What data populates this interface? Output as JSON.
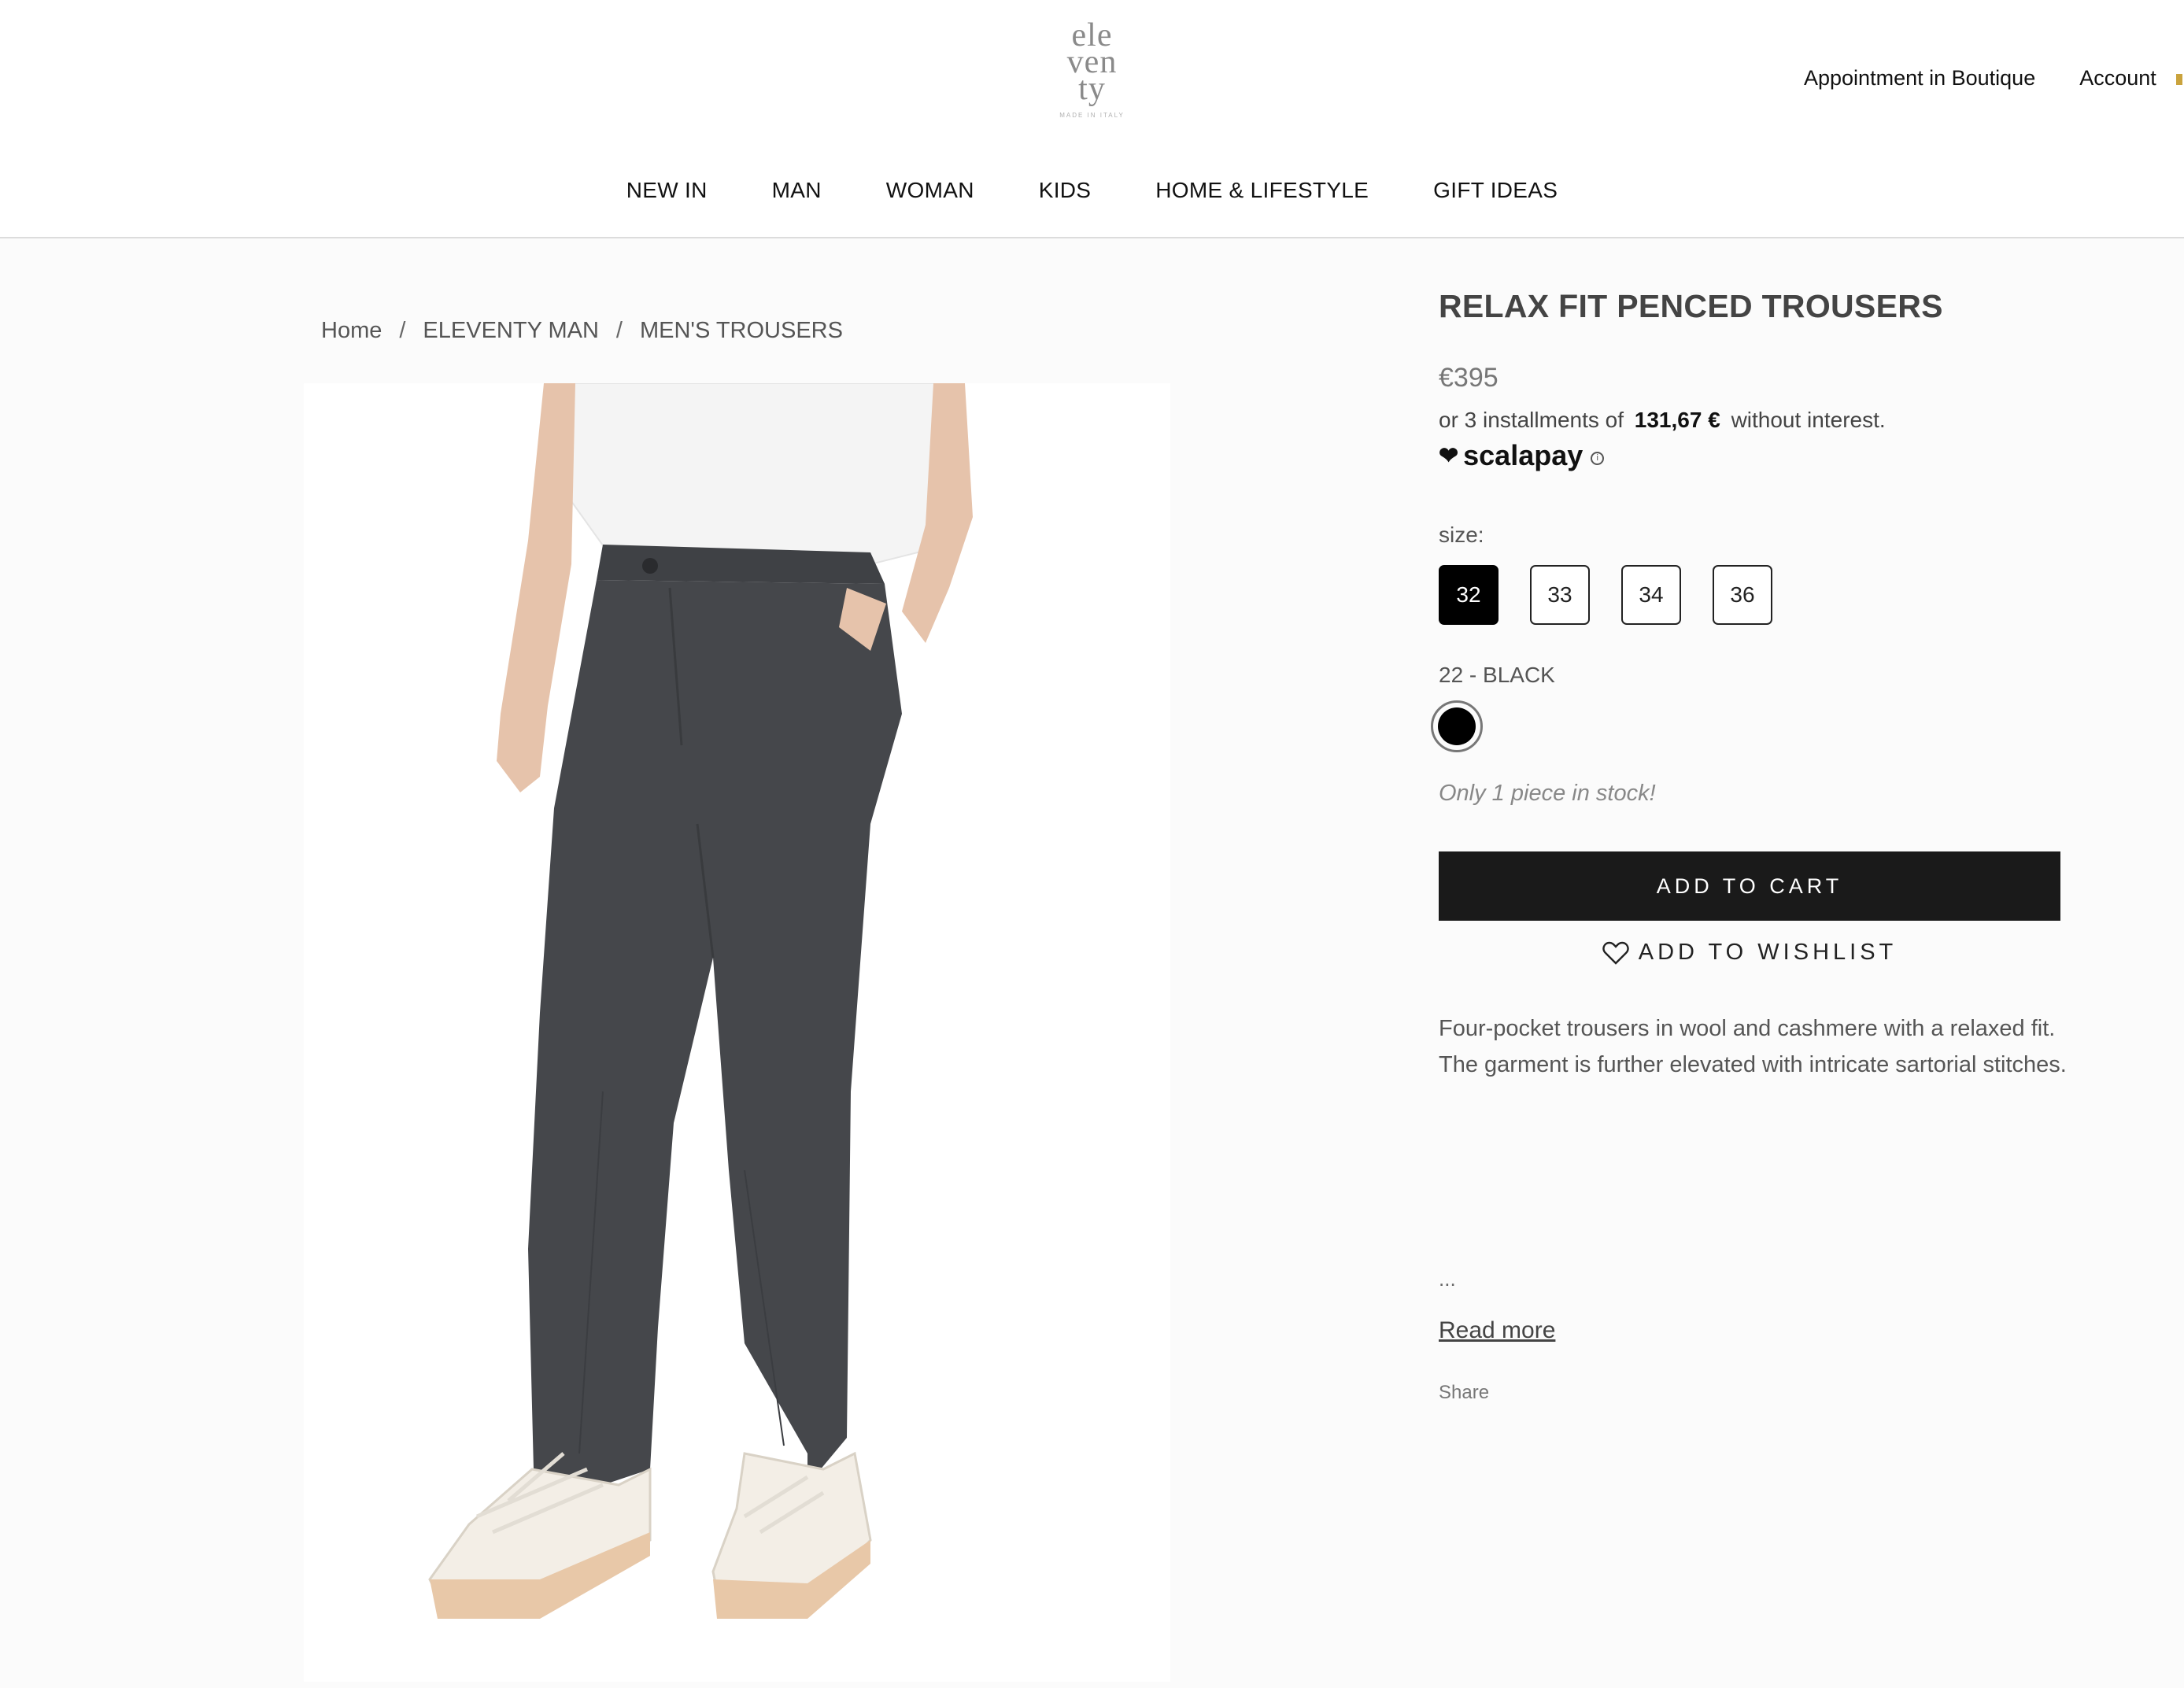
{
  "brand": {
    "logo_lines": [
      "ele",
      "ven",
      "ty"
    ],
    "logo_tagline": "MADE IN ITALY"
  },
  "header": {
    "top_links": [
      "Appointment in Boutique",
      "Account"
    ]
  },
  "nav": {
    "items": [
      "NEW IN",
      "MAN",
      "WOMAN",
      "KIDS",
      "HOME & LIFESTYLE",
      "GIFT IDEAS"
    ]
  },
  "breadcrumb": {
    "items": [
      "Home",
      "ELEVENTY MAN",
      "MEN'S TROUSERS"
    ],
    "separator": "/"
  },
  "product": {
    "title": "RELAX FIT PENCED TROUSERS",
    "price": "€395",
    "installments_prefix": "or 3 installments of",
    "installments_amount": "131,67 €",
    "installments_suffix": "without interest.",
    "payment_provider": "scalapay",
    "size_label": "size:",
    "sizes": [
      "32",
      "33",
      "34",
      "36"
    ],
    "selected_size": "32",
    "color_label": "22 - BLACK",
    "color_hex": "#000000",
    "stock_message": "Only 1 piece in stock!",
    "add_to_cart_label": "ADD TO CART",
    "wishlist_label": "ADD TO WISHLIST",
    "description": "Four-pocket trousers in wool and cashmere with a relaxed fit. The garment is further elevated with intricate sartorial stitches.",
    "ellipsis": "...",
    "read_more_label": "Read more",
    "share_label": "Share"
  },
  "colors": {
    "accent": "#1a1a1a",
    "background": "#fbfbfb",
    "trousers": "#45474b"
  }
}
